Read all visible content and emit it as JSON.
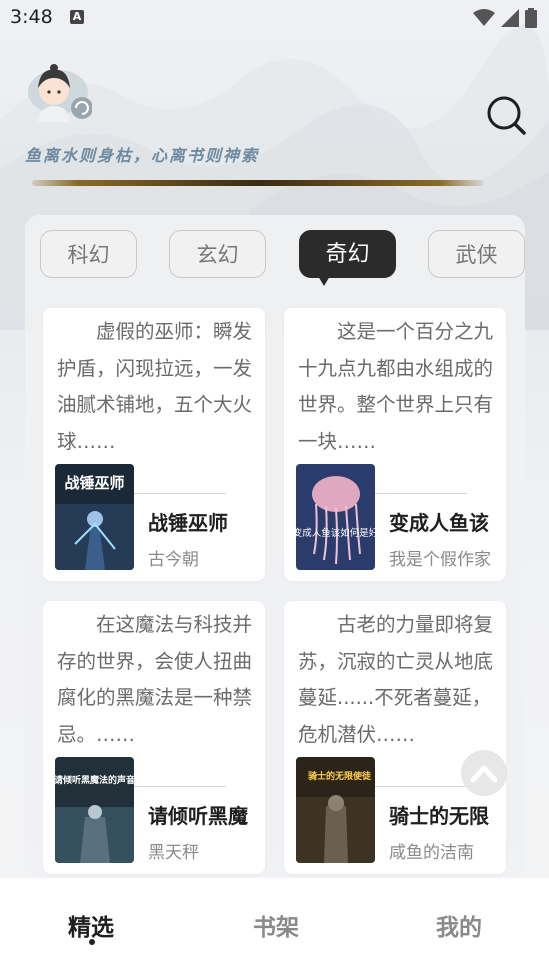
{
  "status_bar": {
    "time": "3:48",
    "notification_icon": "a-icon",
    "icons": [
      "wifi-icon",
      "signal-icon",
      "battery-icon"
    ]
  },
  "header": {
    "avatar_icon": "avatar-icon",
    "search_icon": "search-icon",
    "slogan": "鱼离水则身枯，心离书则神索"
  },
  "tabs": [
    {
      "label": "科幻",
      "active": false
    },
    {
      "label": "玄幻",
      "active": false
    },
    {
      "label": "奇幻",
      "active": true
    },
    {
      "label": "武侠",
      "active": false
    }
  ],
  "books": [
    {
      "description": "虚假的巫师：瞬发护盾，闪现拉远，一发油腻术铺地，五个大火球……",
      "title": "战锤巫师",
      "author": "古今朝",
      "cover_text": "战锤巫师"
    },
    {
      "description": "这是一个百分之九十九点九都由水组成的世界。整个世界上只有一块……",
      "title": "变成人鱼该",
      "author": "我是个假作家",
      "cover_text": "变成人鱼该如何是好"
    },
    {
      "description": "在这魔法与科技并存的世界，会使人扭曲腐化的黑魔法是一种禁忌。……",
      "title": "请倾听黑魔",
      "author": "黑天秤",
      "cover_text": "请倾听黑魔法的声音"
    },
    {
      "description": "古老的力量即将复苏，沉寂的亡灵从地底蔓延......不死者蔓延，危机潜伏……",
      "title": "骑士的无限",
      "author": "咸鱼的洁南",
      "cover_text": "骑士的无限使徒"
    }
  ],
  "scroll_top_icon": "chevron-up-icon",
  "bottom_nav": [
    {
      "label": "精选",
      "active": true
    },
    {
      "label": "书架",
      "active": false
    },
    {
      "label": "我的",
      "active": false
    }
  ],
  "colors": {
    "accent": "#2b2b2b",
    "slogan": "#6e8aa0",
    "background": "#f3f4f6"
  }
}
